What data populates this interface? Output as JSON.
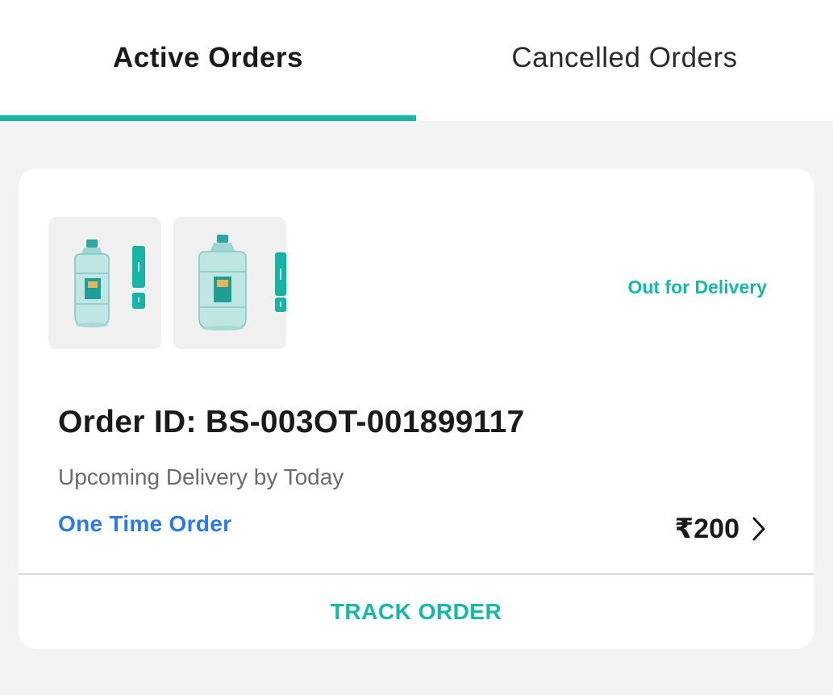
{
  "tabs": [
    {
      "label": "Active Orders",
      "active": true
    },
    {
      "label": "Cancelled Orders",
      "active": false
    }
  ],
  "order": {
    "status": "Out for Delivery",
    "order_id_text": "Order ID: BS-003OT-001899117",
    "delivery_text": "Upcoming Delivery by Today",
    "order_type": "One Time Order",
    "price": "₹200",
    "track_label": "TRACK ORDER",
    "products": [
      {
        "image": "water-jar-20l",
        "label": "20L"
      },
      {
        "image": "water-jar-20l",
        "label": "20 L"
      }
    ]
  },
  "colors": {
    "accent": "#14b8a6",
    "link": "#2c7be5",
    "background": "#f3f3f3"
  }
}
